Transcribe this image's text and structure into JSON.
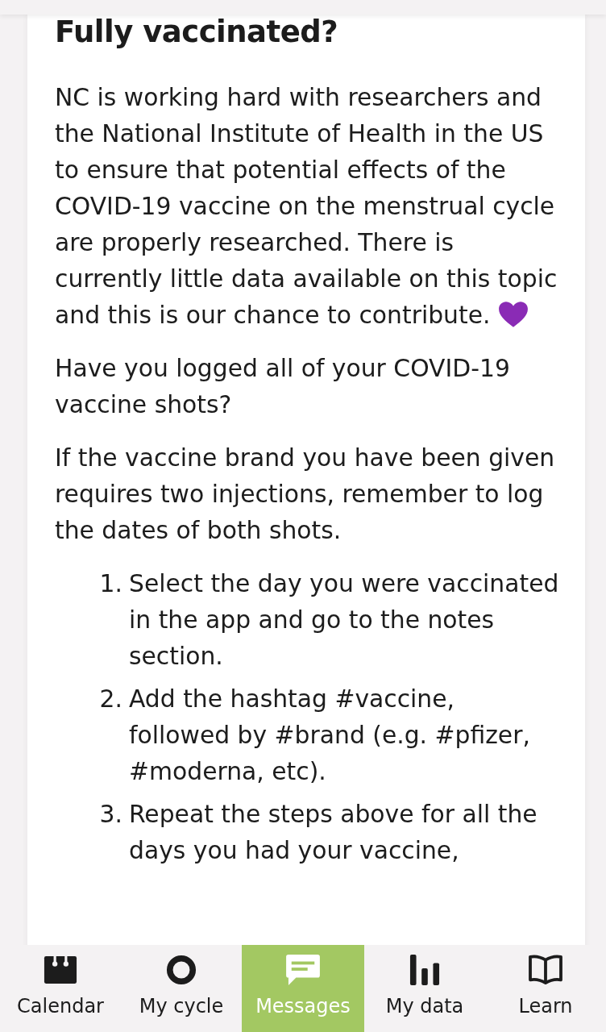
{
  "article": {
    "heading": "Fully vaccinated?",
    "paragraphs": [
      {
        "text": "NC is working hard with researchers and the National Institute of Health in the US to ensure that potential effects of the COVID-19 vaccine on the menstrual cycle are properly researched. There is currently little data available on this topic and this is our chance to contribute.",
        "kind": "heart"
      },
      {
        "text": "Have you logged all of your COVID-19 vaccine shots?",
        "kind": "plain"
      },
      {
        "text": "If the vaccine brand you have been given requires two injections, remember to log the dates of both shots.",
        "kind": "plain"
      }
    ],
    "steps": [
      {
        "number": "1.",
        "text": "Select the day you were vaccinated in the app and go to the notes section."
      },
      {
        "number": "2.",
        "text": "Add the hashtag #vaccine, followed by #brand (e.g. #pfizer, #moderna, etc)."
      },
      {
        "number": "3.",
        "text": "Repeat the steps above for all the days you had your vaccine,"
      }
    ]
  },
  "nav": [
    {
      "label": "Calendar",
      "selected": false
    },
    {
      "label": "My cycle",
      "selected": false
    },
    {
      "label": "Messages",
      "selected": true
    },
    {
      "label": "My data",
      "selected": false
    },
    {
      "label": "Learn",
      "selected": false
    }
  ]
}
